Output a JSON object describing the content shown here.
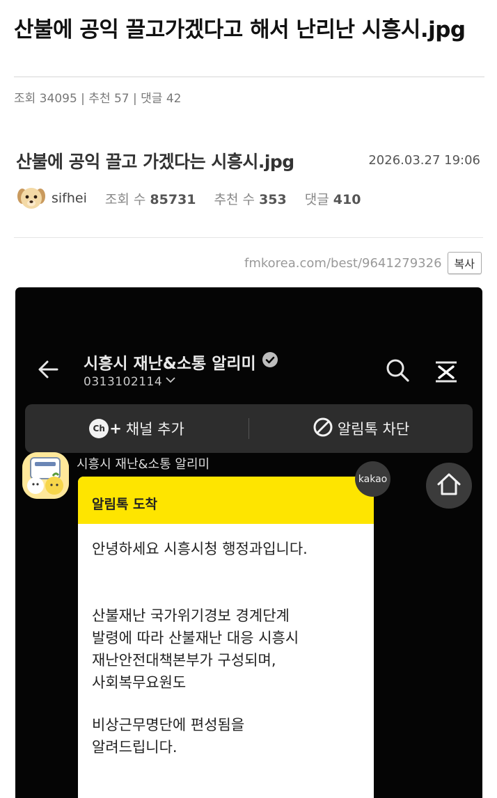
{
  "outer": {
    "title": "산불에 공익 끌고가겠다고 해서 난리난 시흥시.jpg",
    "meta": "조회 34095 | 추천 57 | 댓글 42"
  },
  "post": {
    "title": "산불에 공익 끌고 가겠다는 시흥시.jpg",
    "date": "2026.03.27 19:06",
    "author": "sifhei",
    "views_label": "조회 수",
    "views": "85731",
    "likes_label": "추천 수",
    "likes": "353",
    "comments_label": "댓글",
    "comments": "410",
    "url": "fmkorea.com/best/9641279326",
    "copy_label": "복사"
  },
  "chat": {
    "channel_name": "시흥시 재난&소통 알리미",
    "channel_number": "0313102114",
    "add_channel_label": "채널 추가",
    "add_channel_badge": "Ch",
    "block_label": "알림톡 차단",
    "sender": "시흥시 재난&소통 알리미",
    "kakao_badge": "kakao",
    "bubble_header": "알림톡 도착",
    "line1": "안녕하세요 시흥시청 행정과입니다.",
    "line2": "산불재난 국가위기경보 경계단계",
    "line3": "발령에 따라 산불재난 대응 시흥시",
    "line4": "재난안전대책본부가 구성되며,",
    "line5": "사회복무요원도",
    "line6": "비상근무명단에 편성됨을",
    "line7": "알려드립니다."
  },
  "colors": {
    "kakao_yellow": "#fee500",
    "chat_background": "#050505",
    "action_bar": "#2d2d2d"
  },
  "icons": [
    "back-arrow-icon",
    "verified-badge-icon",
    "chevron-down-icon",
    "search-icon",
    "menu-close-icon",
    "block-icon",
    "home-icon",
    "dog-avatar-icon"
  ]
}
